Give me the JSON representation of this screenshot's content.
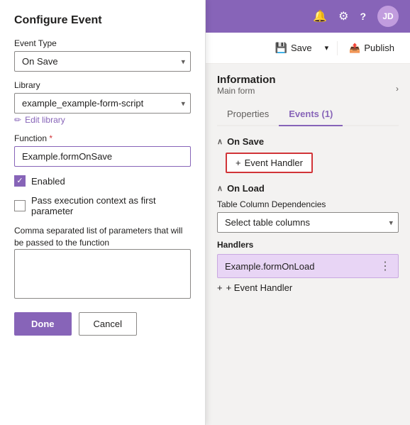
{
  "leftPanel": {
    "title": "Configure Event",
    "eventTypeLabel": "Event Type",
    "eventTypeValue": "On Save",
    "libraryLabel": "Library",
    "libraryValue": "example_example-form-script",
    "editLibraryText": "Edit library",
    "functionLabel": "Function",
    "functionRequired": "*",
    "functionValue": "Example.formOnSave",
    "enabledLabel": "Enabled",
    "passContextLabel": "Pass execution context as first parameter",
    "paramsLabel": "Comma separated list of parameters that will be passed to the function",
    "paramsPlaceholder": "",
    "doneLabel": "Done",
    "cancelLabel": "Cancel"
  },
  "topBar": {
    "bellIcon": "🔔",
    "gearIcon": "⚙",
    "helpIcon": "?",
    "avatarText": "JD"
  },
  "actionBar": {
    "saveIcon": "💾",
    "saveLabel": "Save",
    "arrowLabel": "▾",
    "publishIcon": "📤",
    "publishLabel": "Publish"
  },
  "rightPanel": {
    "infoTitle": "Information",
    "infoSubtitle": "Main form",
    "tabs": [
      {
        "label": "Properties",
        "active": false
      },
      {
        "label": "Events (1)",
        "active": true
      }
    ],
    "onSave": {
      "sectionLabel": "On Save",
      "eventHandlerBtn": "+ Event Handler"
    },
    "onLoad": {
      "sectionLabel": "On Load",
      "tableColLabel": "Table Column Dependencies",
      "tableColPlaceholder": "Select table columns",
      "handlersLabel": "Handlers",
      "handlerItem": "Example.formOnLoad",
      "addHandlerBtn": "+ Event Handler"
    }
  }
}
